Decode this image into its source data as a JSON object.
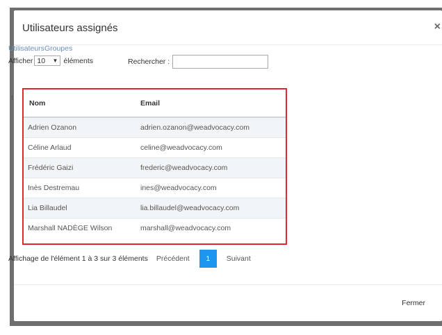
{
  "modal": {
    "title": "Utilisateurs assignés",
    "close_glyph": "×",
    "tabs": [
      "Utilisateurs",
      "Groupes"
    ],
    "show_prefix": "Afficher",
    "page_size": "10",
    "show_suffix": "éléments",
    "search_label": "Rechercher :",
    "search_value": "",
    "left_mark": "t",
    "table": {
      "columns": [
        "Nom",
        "Email"
      ],
      "rows": [
        {
          "name": "Adrien Ozanon",
          "email": "adrien.ozanon@weadvocacy.com"
        },
        {
          "name": "Céline Arlaud",
          "email": "celine@weadvocacy.com"
        },
        {
          "name": "Frédéric Gaizi",
          "email": "frederic@weadvocacy.com"
        },
        {
          "name": "Inès Destremau",
          "email": "ines@weadvocacy.com"
        },
        {
          "name": "Lia Billaudel",
          "email": "lia.billaudel@weadvocacy.com"
        },
        {
          "name": "Marshall NADÈGE Wilson",
          "email": "marshall@weadvocacy.com"
        }
      ]
    },
    "info_text": "Affichage de l'élément 1 à 3 sur 3 éléments",
    "pagination": {
      "previous": "Précédent",
      "current": "1",
      "next": "Suivant"
    },
    "footer_close": "Fermer"
  },
  "colors": {
    "highlight_border": "#e0262f",
    "active_page": "#1e96f0",
    "tab_link": "#6b8fb8"
  }
}
